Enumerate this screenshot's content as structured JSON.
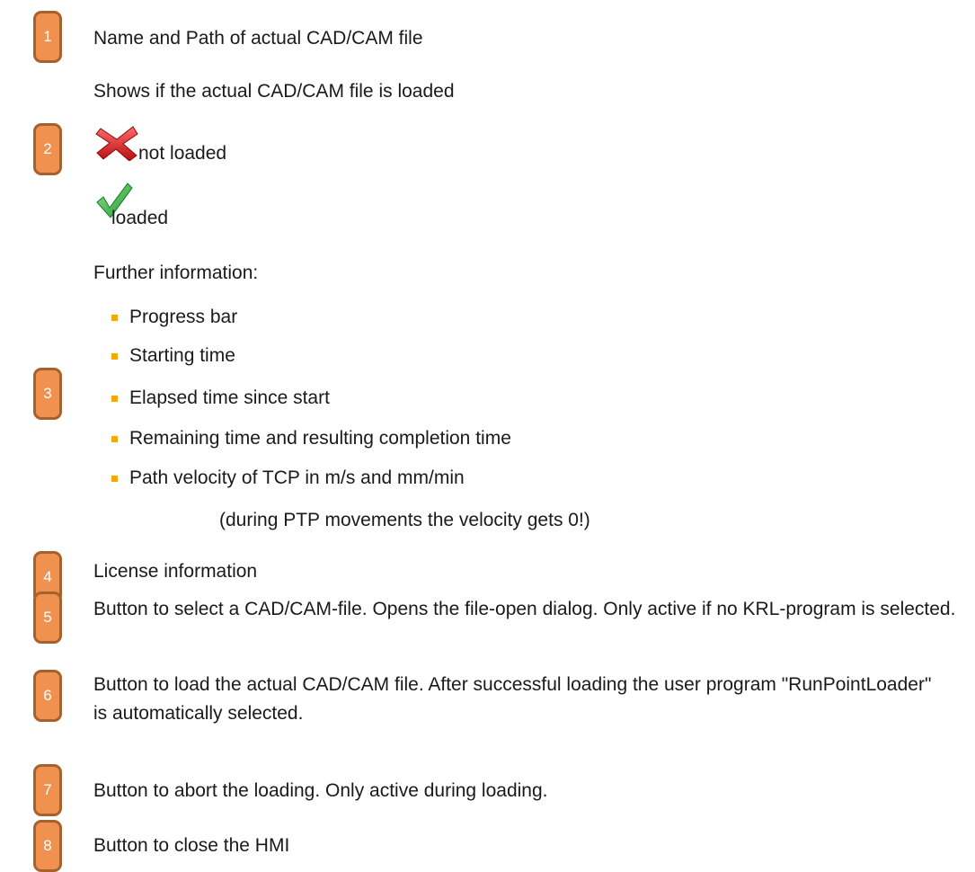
{
  "items": [
    {
      "number": "1",
      "text": "Name and Path of actual CAD/CAM file"
    },
    {
      "number": "2",
      "text": "Shows if the actual CAD/CAM file is loaded",
      "status": [
        {
          "icon": "red-x-icon",
          "label": "not loaded"
        },
        {
          "icon": "green-check-icon",
          "label": "loaded"
        }
      ]
    },
    {
      "number": "3",
      "text": "Further information:",
      "bullets": [
        "Progress bar",
        "Starting time",
        "Elapsed time since start",
        "Remaining time and resulting completion time",
        "Path velocity of TCP in m/s and mm/min"
      ],
      "note": "(during PTP movements the velocity gets 0!)"
    },
    {
      "number": "4",
      "text": "License information"
    },
    {
      "number": "5",
      "text": "Button to select a CAD/CAM-file. Opens the file-open dialog. Only active if no KRL-program is selected."
    },
    {
      "number": "6",
      "text": "Button to load the actual CAD/CAM file. After successful loading the user program \"RunPointLoader\" is automatically selected."
    },
    {
      "number": "7",
      "text": "Button to abort the loading. Only active during loading."
    },
    {
      "number": "8",
      "text": "Button to close the HMI"
    }
  ],
  "colors": {
    "badge_fill": "#f0914f",
    "badge_border": "#a7612d",
    "bullet": "#f5a800",
    "x_red": "#d42020",
    "check_green": "#3cb43c"
  }
}
